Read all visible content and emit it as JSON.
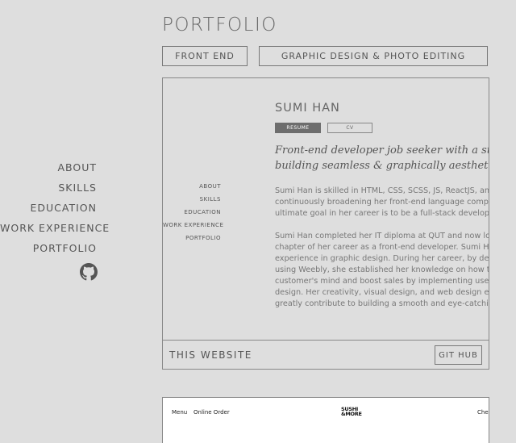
{
  "sidebar": {
    "items": [
      "ABOUT",
      "SKILLS",
      "EDUCATION",
      "WORK EXPERIENCE",
      "PORTFOLIO"
    ]
  },
  "page": {
    "title": "PORTFOLIO"
  },
  "tabs": [
    "FRONT END",
    "GRAPHIC DESIGN & PHOTO EDITING"
  ],
  "project1": {
    "preview": {
      "nav": [
        "ABOUT",
        "SKILLS",
        "EDUCATION",
        "WORK EXPERIENCE",
        "PORTFOLIO"
      ],
      "name": "SUMI HAN",
      "resume_label": "RESUME",
      "cv_label": "CV",
      "tagline": [
        "Front-end developer job seeker with a strong",
        "building seamless & graphically aesthetic we"
      ],
      "para1": [
        "Sumi Han is skilled in HTML, CSS, SCSS, JS, ReactJS, and C",
        "continuously broadening her front-end language compet",
        "ultimate goal in her career is to be a full-stack developer."
      ],
      "para2": [
        "Sumi Han completed her IT diploma at QUT and now look",
        "chapter of her career as a front-end developer. Sumi Han h",
        "experience in graphic design. During her career, by design",
        "using Weebly, she established her knowledge on how to c",
        "customer's mind and boost sales by implementing user-fr",
        "design. Her creativity, visual design, and web design exper",
        "greatly contribute to building a smooth and eye-catching"
      ]
    },
    "title": "THIS WEBSITE",
    "button": "GIT HUB"
  },
  "project2": {
    "menu": "Menu",
    "order": "Online Order",
    "logo": [
      "SUSHI",
      "&MORE"
    ],
    "check": "Chec"
  }
}
